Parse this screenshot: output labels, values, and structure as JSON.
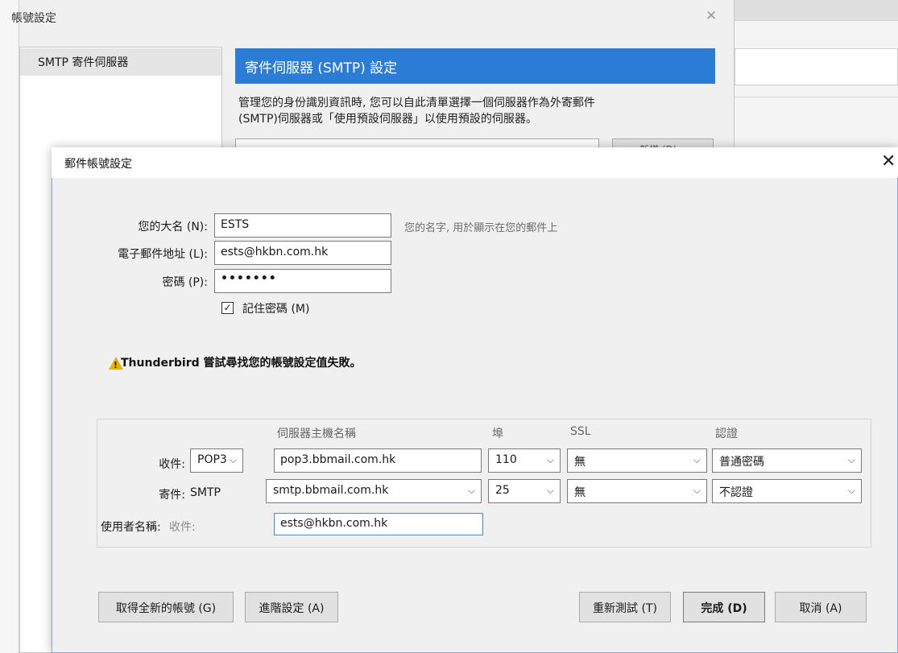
{
  "back_window": {
    "title": "帳號設定",
    "close_icon": "close-icon",
    "nav_item": "SMTP 寄件伺服器",
    "header": "寄件伺服器 (SMTP) 設定",
    "description": "管理您的身份識別資訊時, 您可以自此清單選擇一個伺服器作為外寄郵件\n(SMTP)伺服器或「使用預設伺服器」以使用預設的伺服器。",
    "add_button": "新增 (D)..."
  },
  "dialog": {
    "title": "郵件帳號設定",
    "close_icon": "close-icon",
    "name_label": "您的大名 (N):",
    "name_value": "ESTS",
    "name_hint": "您的名字, 用於顯示在您的郵件上",
    "email_label": "電子郵件地址 (L):",
    "email_value": "ests@hkbn.com.hk",
    "password_label": "密碼 (P):",
    "password_value": "•••••••",
    "remember_label": "記住密碼 (M)",
    "remember_checked": true,
    "warning_icon": "warning-icon",
    "warning_text": "Thunderbird 嘗試尋找您的帳號設定值失敗。"
  },
  "server_table": {
    "headers": {
      "hostname": "伺服器主機名稱",
      "port": "埠",
      "ssl": "SSL",
      "auth": "認證"
    },
    "incoming": {
      "label": "收件:",
      "protocol": "POP3",
      "hostname": "pop3.bbmail.com.hk",
      "port": "110",
      "ssl": "無",
      "auth": "普通密碼"
    },
    "outgoing": {
      "label": "寄件:",
      "protocol": "SMTP",
      "hostname": "smtp.bbmail.com.hk",
      "port": "25",
      "ssl": "無",
      "auth": "不認證"
    },
    "username": {
      "label": "使用者名稱:",
      "sub_label": "收件:",
      "value": "ests@hkbn.com.hk"
    }
  },
  "buttons": {
    "new_account": "取得全新的帳號 (G)",
    "advanced": "進階設定 (A)",
    "retest": "重新測試 (T)",
    "done": "完成 (D)",
    "cancel": "取消 (A)"
  },
  "colors": {
    "header_blue": "#2a7cd4",
    "warning_yellow": "#e6b400",
    "focus_blue": "#3a8ee6"
  }
}
